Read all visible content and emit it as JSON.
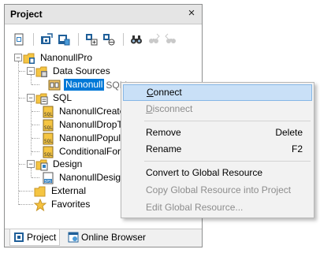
{
  "panel": {
    "title": "Project",
    "close_glyph": "×"
  },
  "toolbar": {
    "buttons": [
      {
        "icon": "new-project-icon",
        "enabled": true
      },
      {
        "icon": "open-project-icon",
        "enabled": true
      },
      {
        "icon": "save-project-icon",
        "enabled": true
      },
      {
        "icon": "add-to-project-icon",
        "enabled": true
      },
      {
        "icon": "add-global-resource-icon",
        "enabled": true
      },
      {
        "icon": "find-icon",
        "enabled": true
      },
      {
        "icon": "find-next-icon",
        "enabled": false
      },
      {
        "icon": "find-previous-icon",
        "enabled": false
      }
    ]
  },
  "tree": {
    "root": "NanonullPro",
    "data_sources": "Data Sources",
    "selected_source": "Nanonull",
    "selected_source_suffix": "SQLite",
    "sql": "SQL",
    "sql_items": [
      "NanonullCreateT",
      "NanonullDropTa",
      "NanonullPopula",
      "ConditionalForm"
    ],
    "design": "Design",
    "design_item": "NanonullDesign",
    "external": "External",
    "favorites": "Favorites"
  },
  "bottom_tabs": [
    {
      "label": "Project",
      "active": true
    },
    {
      "label": "Online Browser",
      "active": false
    }
  ],
  "context_menu": {
    "items": [
      {
        "first": "C",
        "rest": "onnect",
        "shortcut": "",
        "enabled": true,
        "hover": true
      },
      {
        "first": "D",
        "rest": "isconnect",
        "shortcut": "",
        "enabled": false,
        "hover": false
      },
      {
        "label": "Remove",
        "shortcut": "Delete",
        "enabled": true
      },
      {
        "label": "Rename",
        "shortcut": "F2",
        "enabled": true
      },
      {
        "label": "Convert to Global Resource",
        "shortcut": "",
        "enabled": true
      },
      {
        "label": "Copy Global Resource into Project",
        "shortcut": "",
        "enabled": false
      },
      {
        "label": "Edit Global Resource...",
        "shortcut": "",
        "enabled": false
      }
    ]
  },
  "colors": {
    "selection": "#0078d7",
    "menu_hover": "#c9e0f7",
    "menu_bg": "#f2f2f2"
  }
}
